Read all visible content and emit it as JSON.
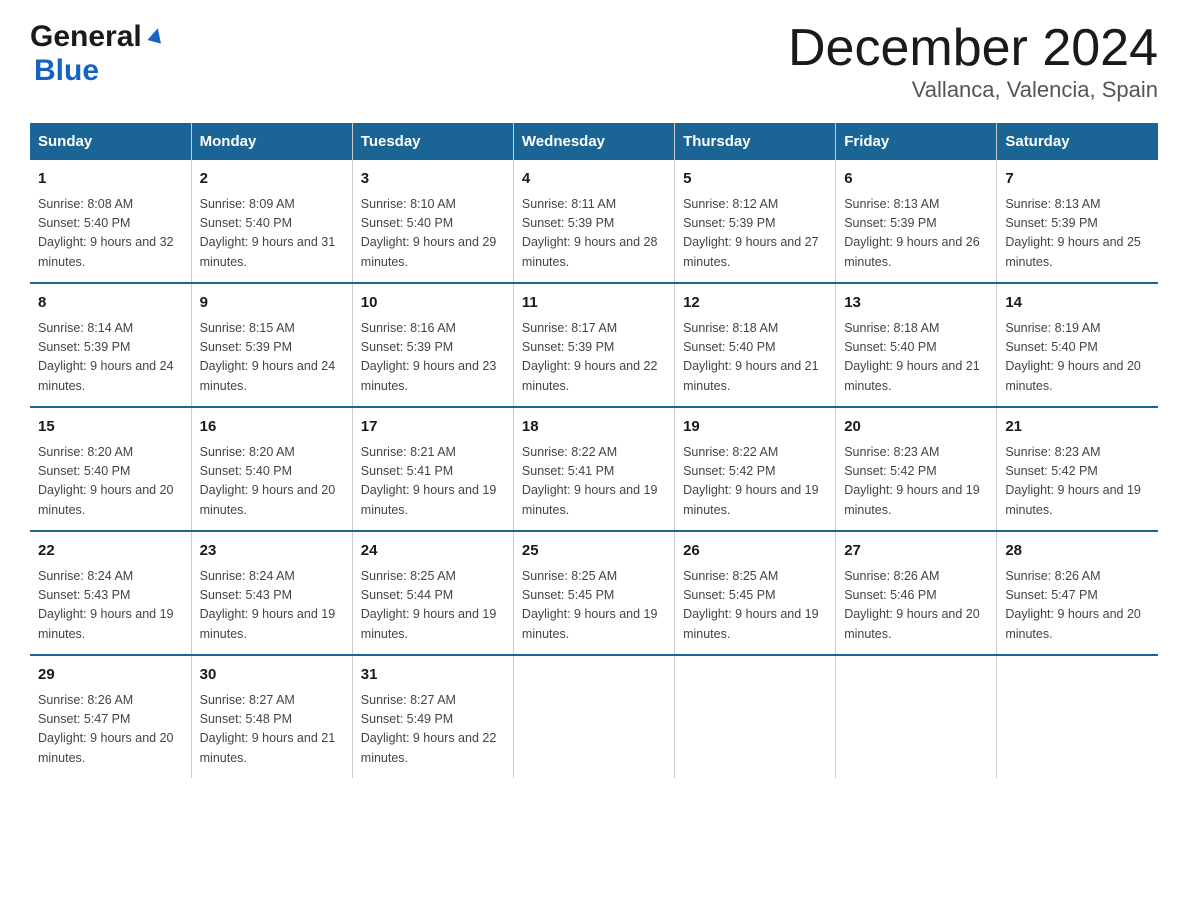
{
  "header": {
    "logo_general": "General",
    "logo_blue": "Blue",
    "month_title": "December 2024",
    "location": "Vallanca, Valencia, Spain"
  },
  "days_of_week": [
    "Sunday",
    "Monday",
    "Tuesday",
    "Wednesday",
    "Thursday",
    "Friday",
    "Saturday"
  ],
  "weeks": [
    [
      {
        "day": "1",
        "sunrise": "8:08 AM",
        "sunset": "5:40 PM",
        "daylight": "9 hours and 32 minutes."
      },
      {
        "day": "2",
        "sunrise": "8:09 AM",
        "sunset": "5:40 PM",
        "daylight": "9 hours and 31 minutes."
      },
      {
        "day": "3",
        "sunrise": "8:10 AM",
        "sunset": "5:40 PM",
        "daylight": "9 hours and 29 minutes."
      },
      {
        "day": "4",
        "sunrise": "8:11 AM",
        "sunset": "5:39 PM",
        "daylight": "9 hours and 28 minutes."
      },
      {
        "day": "5",
        "sunrise": "8:12 AM",
        "sunset": "5:39 PM",
        "daylight": "9 hours and 27 minutes."
      },
      {
        "day": "6",
        "sunrise": "8:13 AM",
        "sunset": "5:39 PM",
        "daylight": "9 hours and 26 minutes."
      },
      {
        "day": "7",
        "sunrise": "8:13 AM",
        "sunset": "5:39 PM",
        "daylight": "9 hours and 25 minutes."
      }
    ],
    [
      {
        "day": "8",
        "sunrise": "8:14 AM",
        "sunset": "5:39 PM",
        "daylight": "9 hours and 24 minutes."
      },
      {
        "day": "9",
        "sunrise": "8:15 AM",
        "sunset": "5:39 PM",
        "daylight": "9 hours and 24 minutes."
      },
      {
        "day": "10",
        "sunrise": "8:16 AM",
        "sunset": "5:39 PM",
        "daylight": "9 hours and 23 minutes."
      },
      {
        "day": "11",
        "sunrise": "8:17 AM",
        "sunset": "5:39 PM",
        "daylight": "9 hours and 22 minutes."
      },
      {
        "day": "12",
        "sunrise": "8:18 AM",
        "sunset": "5:40 PM",
        "daylight": "9 hours and 21 minutes."
      },
      {
        "day": "13",
        "sunrise": "8:18 AM",
        "sunset": "5:40 PM",
        "daylight": "9 hours and 21 minutes."
      },
      {
        "day": "14",
        "sunrise": "8:19 AM",
        "sunset": "5:40 PM",
        "daylight": "9 hours and 20 minutes."
      }
    ],
    [
      {
        "day": "15",
        "sunrise": "8:20 AM",
        "sunset": "5:40 PM",
        "daylight": "9 hours and 20 minutes."
      },
      {
        "day": "16",
        "sunrise": "8:20 AM",
        "sunset": "5:40 PM",
        "daylight": "9 hours and 20 minutes."
      },
      {
        "day": "17",
        "sunrise": "8:21 AM",
        "sunset": "5:41 PM",
        "daylight": "9 hours and 19 minutes."
      },
      {
        "day": "18",
        "sunrise": "8:22 AM",
        "sunset": "5:41 PM",
        "daylight": "9 hours and 19 minutes."
      },
      {
        "day": "19",
        "sunrise": "8:22 AM",
        "sunset": "5:42 PM",
        "daylight": "9 hours and 19 minutes."
      },
      {
        "day": "20",
        "sunrise": "8:23 AM",
        "sunset": "5:42 PM",
        "daylight": "9 hours and 19 minutes."
      },
      {
        "day": "21",
        "sunrise": "8:23 AM",
        "sunset": "5:42 PM",
        "daylight": "9 hours and 19 minutes."
      }
    ],
    [
      {
        "day": "22",
        "sunrise": "8:24 AM",
        "sunset": "5:43 PM",
        "daylight": "9 hours and 19 minutes."
      },
      {
        "day": "23",
        "sunrise": "8:24 AM",
        "sunset": "5:43 PM",
        "daylight": "9 hours and 19 minutes."
      },
      {
        "day": "24",
        "sunrise": "8:25 AM",
        "sunset": "5:44 PM",
        "daylight": "9 hours and 19 minutes."
      },
      {
        "day": "25",
        "sunrise": "8:25 AM",
        "sunset": "5:45 PM",
        "daylight": "9 hours and 19 minutes."
      },
      {
        "day": "26",
        "sunrise": "8:25 AM",
        "sunset": "5:45 PM",
        "daylight": "9 hours and 19 minutes."
      },
      {
        "day": "27",
        "sunrise": "8:26 AM",
        "sunset": "5:46 PM",
        "daylight": "9 hours and 20 minutes."
      },
      {
        "day": "28",
        "sunrise": "8:26 AM",
        "sunset": "5:47 PM",
        "daylight": "9 hours and 20 minutes."
      }
    ],
    [
      {
        "day": "29",
        "sunrise": "8:26 AM",
        "sunset": "5:47 PM",
        "daylight": "9 hours and 20 minutes."
      },
      {
        "day": "30",
        "sunrise": "8:27 AM",
        "sunset": "5:48 PM",
        "daylight": "9 hours and 21 minutes."
      },
      {
        "day": "31",
        "sunrise": "8:27 AM",
        "sunset": "5:49 PM",
        "daylight": "9 hours and 22 minutes."
      },
      null,
      null,
      null,
      null
    ]
  ]
}
